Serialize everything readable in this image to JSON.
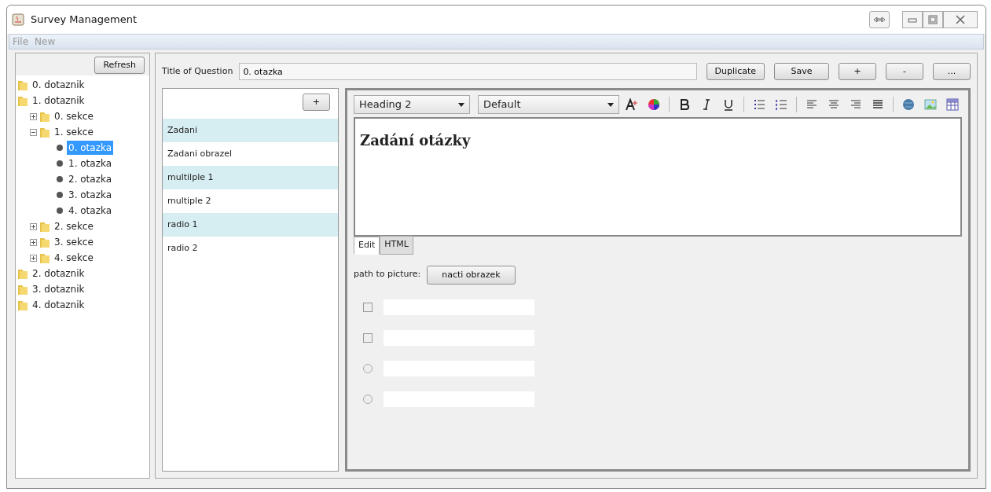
{
  "window": {
    "title": "Survey Management"
  },
  "menu": [
    "File",
    "New"
  ],
  "sidebar": {
    "refresh_button": "Refresh",
    "tree": [
      {
        "label": "0. dotaznik",
        "kind": "folder",
        "selected": false
      },
      {
        "label": "1. dotaznik",
        "kind": "folder",
        "selected": false,
        "children": [
          {
            "label": "0. sekce",
            "kind": "folder",
            "expanded": false,
            "selected": false
          },
          {
            "label": "1. sekce",
            "kind": "folder",
            "expanded": true,
            "selected": false,
            "children": [
              {
                "label": "0. otazka",
                "kind": "leaf",
                "selected": true
              },
              {
                "label": "1. otazka",
                "kind": "leaf",
                "selected": false
              },
              {
                "label": "2. otazka",
                "kind": "leaf",
                "selected": false
              },
              {
                "label": "3. otazka",
                "kind": "leaf",
                "selected": false
              },
              {
                "label": "4. otazka",
                "kind": "leaf",
                "selected": false
              }
            ]
          },
          {
            "label": "2. sekce",
            "kind": "folder",
            "expanded": false,
            "selected": false
          },
          {
            "label": "3. sekce",
            "kind": "folder",
            "expanded": false,
            "selected": false
          },
          {
            "label": "4. sekce",
            "kind": "folder",
            "expanded": false,
            "selected": false
          }
        ]
      },
      {
        "label": "2. dotaznik",
        "kind": "folder",
        "selected": false
      },
      {
        "label": "3. dotaznik",
        "kind": "folder",
        "selected": false
      },
      {
        "label": "4. dotaznik",
        "kind": "folder",
        "selected": false
      }
    ]
  },
  "question": {
    "title_label": "Title of Question",
    "title_value": "0. otazka",
    "buttons": [
      "Duplicate",
      "Save",
      "+",
      "-",
      "..."
    ]
  },
  "parts": {
    "add_button": "+",
    "items": [
      "Zadani",
      "Zadani obrazel",
      "multilple 1",
      "multiple 2",
      "radio 1",
      "radio 2"
    ]
  },
  "editor": {
    "style_select": "Heading 2",
    "font_select": "Default",
    "heading": "Zadání otázky",
    "tabs": [
      {
        "label": "Edit",
        "selected": true
      },
      {
        "label": "HTML",
        "selected": false
      }
    ],
    "picture_label": "path to picture:",
    "picture_button": "nacti obrazek",
    "answers": [
      {
        "kind": "checkbox",
        "checked": false
      },
      {
        "kind": "checkbox",
        "checked": false
      },
      {
        "kind": "radio",
        "checked": false
      },
      {
        "kind": "radio",
        "checked": false
      }
    ]
  }
}
